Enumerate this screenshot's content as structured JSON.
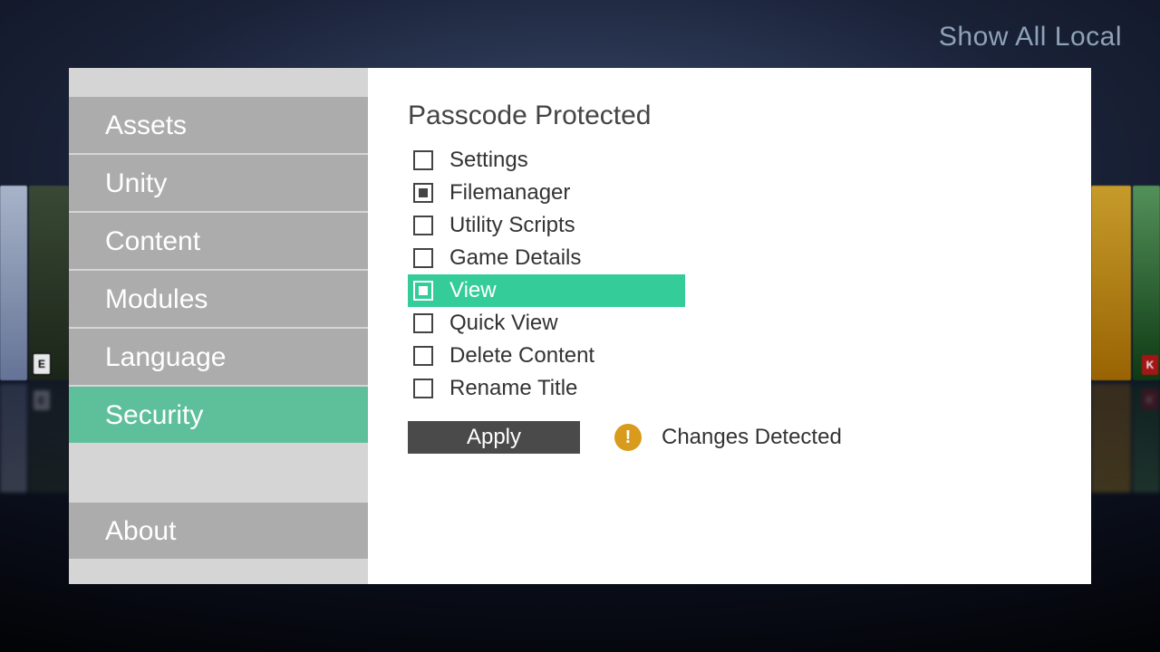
{
  "header": {
    "top_link": "Show All Local"
  },
  "sidebar": {
    "items": [
      {
        "label": "Assets",
        "selected": false
      },
      {
        "label": "Unity",
        "selected": false
      },
      {
        "label": "Content",
        "selected": false
      },
      {
        "label": "Modules",
        "selected": false
      },
      {
        "label": "Language",
        "selected": false
      },
      {
        "label": "Security",
        "selected": true
      },
      {
        "label": "About",
        "selected": false
      }
    ]
  },
  "panel": {
    "title": "Passcode Protected",
    "options": [
      {
        "label": "Settings",
        "checked": false,
        "highlight": false
      },
      {
        "label": "Filemanager",
        "checked": true,
        "highlight": false
      },
      {
        "label": "Utility Scripts",
        "checked": false,
        "highlight": false
      },
      {
        "label": "Game Details",
        "checked": false,
        "highlight": false
      },
      {
        "label": "View",
        "checked": true,
        "highlight": true
      },
      {
        "label": "Quick View",
        "checked": false,
        "highlight": false
      },
      {
        "label": "Delete Content",
        "checked": false,
        "highlight": false
      },
      {
        "label": "Rename Title",
        "checked": false,
        "highlight": false
      }
    ],
    "apply_label": "Apply",
    "status_text": "Changes Detected"
  },
  "colors": {
    "accent": "#5ec09a",
    "highlight": "#34cc99",
    "warn": "#d89b1c"
  }
}
